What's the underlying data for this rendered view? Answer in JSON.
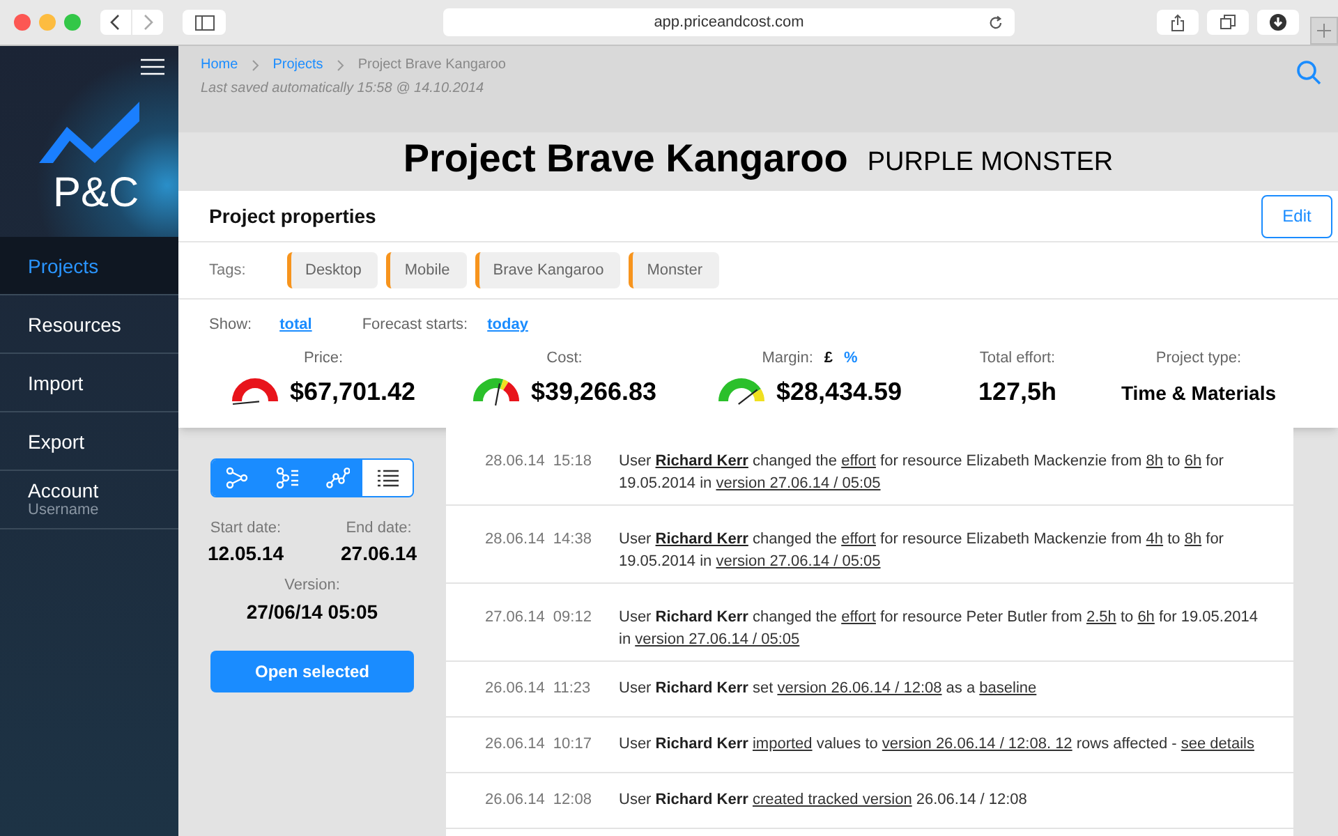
{
  "browser": {
    "url": "app.priceandcost.com"
  },
  "sidebar": {
    "items": [
      {
        "label": "Projects",
        "selected": true
      },
      {
        "label": "Resources",
        "selected": false
      },
      {
        "label": "Import",
        "selected": false
      },
      {
        "label": "Export",
        "selected": false
      },
      {
        "label": "Account",
        "sublabel": "Username",
        "selected": false
      }
    ],
    "logo": "P&C"
  },
  "breadcrumb": [
    {
      "label": "Home",
      "kind": "link"
    },
    {
      "label": "Projects",
      "kind": "link"
    },
    {
      "label": "Project Brave Kangaroo",
      "kind": "current"
    }
  ],
  "last_saved": "Last saved automatically 15:58 @ 14.10.2014",
  "title": "Project Brave Kangaroo",
  "subtitle": "PURPLE MONSTER",
  "properties": {
    "heading": "Project properties",
    "edit_button": "Edit",
    "tags_label": "Tags:",
    "tags": [
      {
        "label": "Desktop",
        "color": "#f7941d"
      },
      {
        "label": "Mobile",
        "color": "#f7941d"
      },
      {
        "label": "Brave Kangaroo",
        "color": "#f7941d"
      },
      {
        "label": "Monster",
        "color": "#f7941d"
      }
    ],
    "show_label": "Show:",
    "show_value": "total",
    "forecast_label": "Forecast starts:",
    "forecast_value": "today",
    "metrics": [
      {
        "label": "Price:",
        "value": "$67,701.42",
        "gauge": {
          "kind": "red"
        }
      },
      {
        "label": "Cost:",
        "value": "$39,266.83",
        "gauge": {
          "kind": "mixed"
        }
      },
      {
        "label": "Margin:",
        "value": "$28,434.59",
        "units": [
          {
            "label": "£",
            "selected": true
          },
          {
            "label": "%",
            "selected": false
          }
        ],
        "gauge": {
          "kind": "green"
        }
      },
      {
        "label": "Total effort:",
        "value": "127,5h"
      },
      {
        "label": "Project type:",
        "value": "Time & Materials"
      }
    ]
  },
  "views": [
    {
      "selected": false
    },
    {
      "selected": false
    },
    {
      "selected": false
    },
    {
      "selected": true
    }
  ],
  "dates": {
    "start_label": "Start date:",
    "start": "12.05.14",
    "end_label": "End date:",
    "end": "27.06.14",
    "version_label": "Version:",
    "version": "27/06/14 05:05"
  },
  "open_button": "Open selected",
  "log": [
    {
      "date": "28.06.14",
      "time": "15:18",
      "segments": [
        {
          "kind": "plain",
          "text": "User "
        },
        {
          "kind": "bold_link",
          "text": "Richard Kerr"
        },
        {
          "kind": "plain",
          "text": " changed the "
        },
        {
          "kind": "link",
          "text": "effort"
        },
        {
          "kind": "plain",
          "text": " for resource Elizabeth Mackenzie from "
        },
        {
          "kind": "link",
          "text": "8h"
        },
        {
          "kind": "plain",
          "text": " to "
        },
        {
          "kind": "link",
          "text": "6h"
        },
        {
          "kind": "plain",
          "text": " for 19.05.2014 in "
        },
        {
          "kind": "link",
          "text": "version 27.06.14 / 05:05"
        }
      ]
    },
    {
      "date": "28.06.14",
      "time": "14:38",
      "segments": [
        {
          "kind": "plain",
          "text": "User "
        },
        {
          "kind": "bold_link",
          "text": "Richard Kerr"
        },
        {
          "kind": "plain",
          "text": " changed the "
        },
        {
          "kind": "link",
          "text": "effort"
        },
        {
          "kind": "plain",
          "text": " for resource Elizabeth Mackenzie from "
        },
        {
          "kind": "link",
          "text": "4h"
        },
        {
          "kind": "plain",
          "text": " to "
        },
        {
          "kind": "link",
          "text": "8h"
        },
        {
          "kind": "plain",
          "text": " for 19.05.2014 in "
        },
        {
          "kind": "link",
          "text": "version 27.06.14 / 05:05"
        }
      ]
    },
    {
      "date": "27.06.14",
      "time": "09:12",
      "segments": [
        {
          "kind": "plain",
          "text": "User "
        },
        {
          "kind": "bold",
          "text": "Richard Kerr"
        },
        {
          "kind": "plain",
          "text": " changed the "
        },
        {
          "kind": "link",
          "text": "effort"
        },
        {
          "kind": "plain",
          "text": " for resource Peter Butler from "
        },
        {
          "kind": "link",
          "text": "2.5h"
        },
        {
          "kind": "plain",
          "text": " to "
        },
        {
          "kind": "link",
          "text": "6h"
        },
        {
          "kind": "plain",
          "text": " for 19.05.2014  in "
        },
        {
          "kind": "link",
          "text": "version 27.06.14 / 05:05"
        }
      ]
    },
    {
      "date": "26.06.14",
      "time": "11:23",
      "segments": [
        {
          "kind": "plain",
          "text": "User "
        },
        {
          "kind": "bold",
          "text": "Richard Kerr"
        },
        {
          "kind": "plain",
          "text": " set "
        },
        {
          "kind": "link",
          "text": "version 26.06.14 / 12:08"
        },
        {
          "kind": "plain",
          "text": " as a "
        },
        {
          "kind": "link",
          "text": "baseline"
        }
      ]
    },
    {
      "date": "26.06.14",
      "time": "10:17",
      "segments": [
        {
          "kind": "plain",
          "text": "User "
        },
        {
          "kind": "bold",
          "text": "Richard Kerr "
        },
        {
          "kind": "link",
          "text": "imported"
        },
        {
          "kind": "plain",
          "text": " values to "
        },
        {
          "kind": "link",
          "text": "version 26.06.14 / 12:08. 12"
        },
        {
          "kind": "plain",
          "text": " rows affected - "
        },
        {
          "kind": "link",
          "text": "see details"
        }
      ]
    },
    {
      "date": "26.06.14",
      "time": "12:08",
      "segments": [
        {
          "kind": "plain",
          "text": "User "
        },
        {
          "kind": "bold",
          "text": "Richard Kerr "
        },
        {
          "kind": "link",
          "text": "created tracked version"
        },
        {
          "kind": "plain",
          "text": " 26.06.14 / 12:08"
        }
      ]
    }
  ]
}
